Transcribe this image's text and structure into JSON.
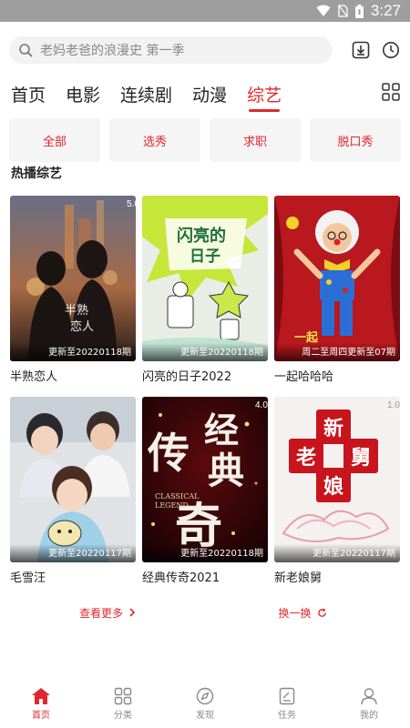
{
  "status_bar": {
    "time": "3:27",
    "icons": [
      "wifi-icon",
      "no-sim-icon",
      "battery-icon"
    ]
  },
  "search": {
    "placeholder": "老妈老爸的浪漫史 第一季"
  },
  "header_icons": [
    "download-icon",
    "history-clock-icon"
  ],
  "tabs": [
    {
      "label": "首页",
      "active": false
    },
    {
      "label": "电影",
      "active": false
    },
    {
      "label": "连续剧",
      "active": false
    },
    {
      "label": "动漫",
      "active": false
    },
    {
      "label": "综艺",
      "active": true
    }
  ],
  "chips": [
    "全部",
    "选秀",
    "求职",
    "脱口秀"
  ],
  "section": {
    "title": "热播综艺"
  },
  "cards": [
    {
      "title": "半熟恋人",
      "episode": "更新至20220118期",
      "rating": "5.0"
    },
    {
      "title": "闪亮的日子2022",
      "episode": "更新至20220118期",
      "rating": ""
    },
    {
      "title": "一起哈哈哈",
      "episode": "周二至周四更新至07期",
      "rating": ""
    },
    {
      "title": "毛雪汪",
      "episode": "更新至20220117期",
      "rating": ""
    },
    {
      "title": "经典传奇2021",
      "episode": "更新至20220118期",
      "rating": "4.0"
    },
    {
      "title": "新老娘舅",
      "episode": "更新至20220117期",
      "rating": "1.0"
    }
  ],
  "actions": {
    "more": "查看更多",
    "refresh": "换一换"
  },
  "bottom_nav": [
    {
      "label": "首页",
      "icon": "home-icon",
      "active": true
    },
    {
      "label": "分类",
      "icon": "category-grid-icon",
      "active": false
    },
    {
      "label": "发现",
      "icon": "compass-icon",
      "active": false
    },
    {
      "label": "任务",
      "icon": "task-icon",
      "active": false
    },
    {
      "label": "我的",
      "icon": "user-icon",
      "active": false
    }
  ],
  "colors": {
    "accent": "#e0282e",
    "status_bar": "#9e9e9e",
    "chip_bg": "#f5f5f5",
    "search_bg": "#f2f2f2"
  }
}
